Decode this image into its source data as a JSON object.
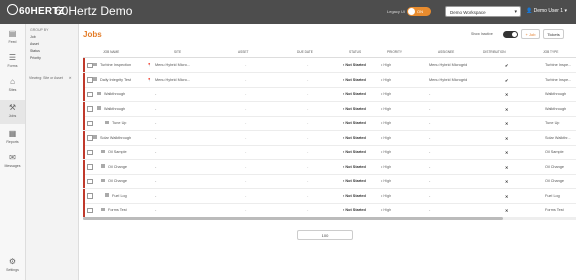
{
  "topbar": {
    "logo": "60HERTZ",
    "title": "60Hertz Demo",
    "legacy_label": "Legacy UI",
    "legacy_toggle": "ON",
    "workspace": "Demo Workspace",
    "user": "Demo User 1"
  },
  "sidebar": {
    "items": [
      {
        "label": "Feed",
        "icon": "feed-icon"
      },
      {
        "label": "Forms",
        "icon": "forms-icon"
      },
      {
        "label": "Sites",
        "icon": "sites-icon"
      },
      {
        "label": "Jobs",
        "icon": "jobs-icon"
      },
      {
        "label": "Reports",
        "icon": "reports-icon"
      },
      {
        "label": "Messages",
        "icon": "messages-icon"
      },
      {
        "label": "Settings",
        "icon": "settings-icon"
      }
    ]
  },
  "subpanel": {
    "group_label": "GROUP BY",
    "items": [
      "Job",
      "Asset",
      "Status",
      "Priority"
    ],
    "viewing": "Viewing: Site or Asset",
    "viewing_close": "✕"
  },
  "main": {
    "title": "Jobs",
    "show_inactive_label": "Show Inactive",
    "add_job_label": "+ Job",
    "tickets_label": "Tickets"
  },
  "table": {
    "headers": [
      "JOB NAME",
      "SITE",
      "ASSET",
      "DUE DATE",
      "STATUS",
      "PRIORITY",
      "ASSIGNEE",
      "DISTRIBUTION",
      "JOB TYPE"
    ],
    "rows": [
      {
        "name": "Turbine Inspection",
        "pin": "📍",
        "site": "Menu Hybrid Micro...",
        "asset": "-",
        "due": "-",
        "status": "Not Started",
        "priority": "High",
        "assignee": "Menu Hybrid Microgrid",
        "dist": "✔",
        "type": "Turbine Inspe..."
      },
      {
        "name": "Daily Integrity Test",
        "pin": "📍",
        "site": "Menu Hybrid Micro...",
        "asset": "-",
        "due": "-",
        "status": "Not Started",
        "priority": "High",
        "assignee": "Menu Hybrid Microgrid",
        "dist": "✔",
        "type": "Turbine Inspe..."
      },
      {
        "name": "Walkthrough",
        "pin": "",
        "site": "-",
        "asset": "-",
        "due": "-",
        "status": "Not Started",
        "priority": "High",
        "assignee": "-",
        "dist": "✕",
        "type": "Walkthrough"
      },
      {
        "name": "Walkthrough",
        "pin": "",
        "site": "-",
        "asset": "-",
        "due": "-",
        "status": "Not Started",
        "priority": "High",
        "assignee": "-",
        "dist": "✕",
        "type": "Walkthrough"
      },
      {
        "name": "Tune Up",
        "pin": "",
        "site": "-",
        "asset": "-",
        "due": "-",
        "status": "Not Started",
        "priority": "High",
        "assignee": "-",
        "dist": "✕",
        "type": "Tune Up"
      },
      {
        "name": "Solar Walkthrough",
        "pin": "",
        "site": "-",
        "asset": "-",
        "due": "-",
        "status": "Not Started",
        "priority": "High",
        "assignee": "-",
        "dist": "✕",
        "type": "Solar Walkthr..."
      },
      {
        "name": "Oil Sample",
        "pin": "",
        "site": "-",
        "asset": "-",
        "due": "-",
        "status": "Not Started",
        "priority": "High",
        "assignee": "-",
        "dist": "✕",
        "type": "Oil Sample"
      },
      {
        "name": "Oil Change",
        "pin": "",
        "site": "-",
        "asset": "-",
        "due": "-",
        "status": "Not Started",
        "priority": "High",
        "assignee": "-",
        "dist": "✕",
        "type": "Oil Change"
      },
      {
        "name": "Oil Change",
        "pin": "",
        "site": "-",
        "asset": "-",
        "due": "-",
        "status": "Not Started",
        "priority": "High",
        "assignee": "-",
        "dist": "✕",
        "type": "Oil Change"
      },
      {
        "name": "Fuel Log",
        "pin": "",
        "site": "-",
        "asset": "-",
        "due": "-",
        "status": "Not Started",
        "priority": "High",
        "assignee": "-",
        "dist": "✕",
        "type": "Fuel Log"
      },
      {
        "name": "Forms Test",
        "pin": "",
        "site": "-",
        "asset": "-",
        "due": "-",
        "status": "Not Started",
        "priority": "High",
        "assignee": "-",
        "dist": "✕",
        "type": "Forms Test"
      }
    ]
  },
  "pager": {
    "page_size": "100"
  },
  "colors": {
    "accent": "#e37b26",
    "topbar": "#4d4d4d",
    "row_bar": "#c0392b"
  }
}
